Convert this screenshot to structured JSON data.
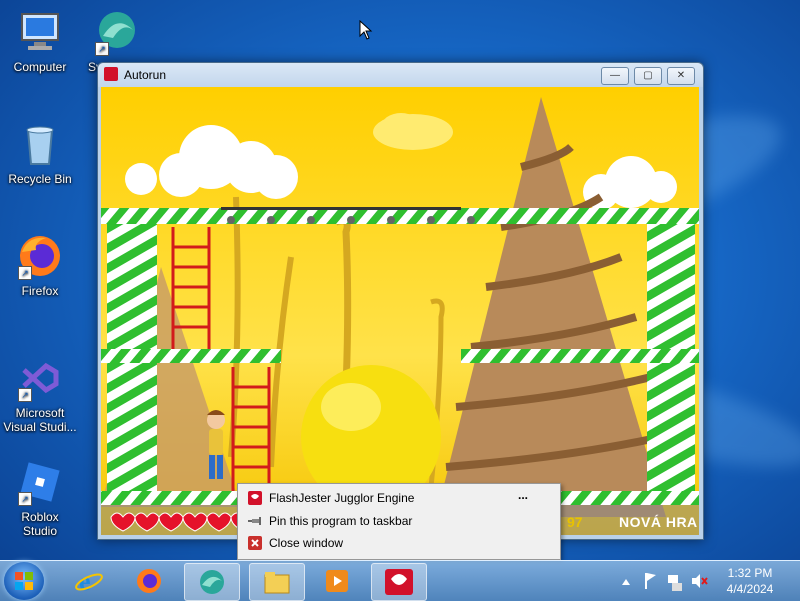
{
  "desktop": {
    "icons": [
      {
        "label": "Computer",
        "icon": "computer-icon"
      },
      {
        "label": "Recycle Bin",
        "icon": "recycle-bin-icon"
      },
      {
        "label": "Firefox",
        "icon": "firefox-icon"
      },
      {
        "label": "Microsoft Visual Studi...",
        "icon": "visual-studio-icon"
      },
      {
        "label": "Roblox Studio",
        "icon": "roblox-studio-icon"
      },
      {
        "label": "Sv",
        "icon": "app-shortcut-icon"
      }
    ]
  },
  "window": {
    "title": "Autorun",
    "minimize_label": "—",
    "maximize_label": "▢",
    "close_label": "✕"
  },
  "game": {
    "score": "97",
    "new_game_label": "NOVÁ HRA",
    "lives": 6
  },
  "menu": {
    "items": [
      {
        "label": "FlashJester Jugglor Engine",
        "icon": "app-icon",
        "more": "..."
      },
      {
        "label": "Pin this program to taskbar",
        "icon": "pin-icon"
      },
      {
        "label": "Close window",
        "icon": "close-icon"
      }
    ]
  },
  "taskbar": {
    "apps": [
      "internet-explorer-icon",
      "firefox-icon",
      "edge-icon",
      "file-explorer-icon",
      "media-player-icon",
      "autorun-icon"
    ],
    "time": "1:32 PM",
    "date": "4/4/2024"
  },
  "colors": {
    "game_yellow": "#ffd400",
    "stripe_green": "#2fbf2f",
    "menu_bg": "#f0f0f0"
  }
}
